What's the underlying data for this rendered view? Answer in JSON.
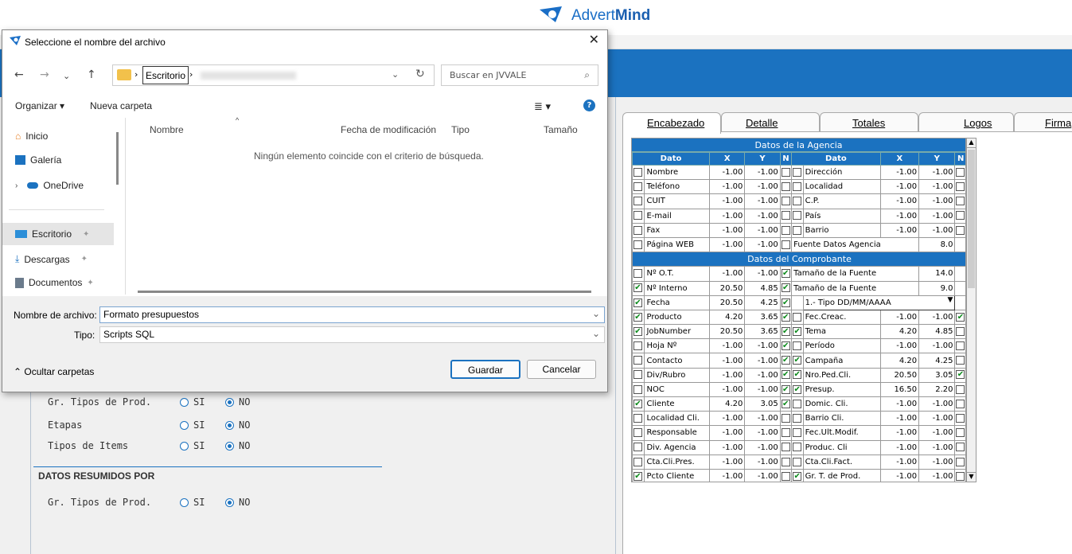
{
  "brand": {
    "name_plain": "Advert",
    "name_bold": "Mind"
  },
  "tabs": [
    "Encabezado",
    "Detalle",
    "Totales",
    "Logos",
    "Firma"
  ],
  "grid": {
    "section1_title": "Datos de la Agencia",
    "headers": [
      "Dato",
      "X",
      "Y",
      "N",
      "Dato",
      "X",
      "Y",
      "N"
    ],
    "rows1": [
      {
        "c1": false,
        "l": "Nombre",
        "x": "-1.00",
        "y": "-1.00",
        "n": false,
        "c2": false,
        "r": "Dirección",
        "rx": "-1.00",
        "ry": "-1.00",
        "rn": false
      },
      {
        "c1": false,
        "l": "Teléfono",
        "x": "-1.00",
        "y": "-1.00",
        "n": false,
        "c2": false,
        "r": "Localidad",
        "rx": "-1.00",
        "ry": "-1.00",
        "rn": false
      },
      {
        "c1": false,
        "l": "CUIT",
        "x": "-1.00",
        "y": "-1.00",
        "n": false,
        "c2": false,
        "r": "C.P.",
        "rx": "-1.00",
        "ry": "-1.00",
        "rn": false
      },
      {
        "c1": false,
        "l": "E-mail",
        "x": "-1.00",
        "y": "-1.00",
        "n": false,
        "c2": false,
        "r": "País",
        "rx": "-1.00",
        "ry": "-1.00",
        "rn": false
      },
      {
        "c1": false,
        "l": "Fax",
        "x": "-1.00",
        "y": "-1.00",
        "n": false,
        "c2": false,
        "r": "Barrio",
        "rx": "-1.00",
        "ry": "-1.00",
        "rn": false
      }
    ],
    "web_row": {
      "l": "Página WEB",
      "x": "-1.00",
      "y": "-1.00",
      "font_label": "Fuente Datos Agencia",
      "font_val": "8.0"
    },
    "section2_title": "Datos del Comprobante",
    "ot_row": {
      "l": "Nº O.T.",
      "x": "-1.00",
      "y": "-1.00",
      "n": true,
      "fl": "Tamaño de la Fuente",
      "fv": "14.0"
    },
    "int_row": {
      "l": "Nº Interno",
      "x": "20.50",
      "y": "4.85",
      "n": true,
      "fl": "Tamaño de la Fuente",
      "fv": "9.0"
    },
    "fecha_row": {
      "l": "Fecha",
      "x": "20.50",
      "y": "4.25",
      "n": true,
      "sel": "1.- Tipo DD/MM/AAAA"
    },
    "rows2": [
      {
        "c1": true,
        "l": "Producto",
        "x": "4.20",
        "y": "3.65",
        "n": true,
        "c2": false,
        "r": "Fec.Creac.",
        "rx": "-1.00",
        "ry": "-1.00",
        "rn": true
      },
      {
        "c1": true,
        "l": "JobNumber",
        "x": "20.50",
        "y": "3.65",
        "n": true,
        "c2": true,
        "r": "Tema",
        "rx": "4.20",
        "ry": "4.85",
        "rn": false
      },
      {
        "c1": false,
        "l": "Hoja Nº",
        "x": "-1.00",
        "y": "-1.00",
        "n": true,
        "c2": false,
        "r": "Período",
        "rx": "-1.00",
        "ry": "-1.00",
        "rn": false
      },
      {
        "c1": false,
        "l": "Contacto",
        "x": "-1.00",
        "y": "-1.00",
        "n": true,
        "c2": true,
        "r": "Campaña",
        "rx": "4.20",
        "ry": "4.25",
        "rn": false
      },
      {
        "c1": false,
        "l": "Div/Rubro",
        "x": "-1.00",
        "y": "-1.00",
        "n": true,
        "c2": true,
        "r": "Nro.Ped.Cli.",
        "rx": "20.50",
        "ry": "3.05",
        "rn": true
      },
      {
        "c1": false,
        "l": "NOC",
        "x": "-1.00",
        "y": "-1.00",
        "n": true,
        "c2": true,
        "r": "Presup.",
        "rx": "16.50",
        "ry": "2.20",
        "rn": false
      },
      {
        "c1": true,
        "l": "Cliente",
        "x": "4.20",
        "y": "3.05",
        "n": true,
        "c2": false,
        "r": "Domic. Cli.",
        "rx": "-1.00",
        "ry": "-1.00",
        "rn": false
      },
      {
        "c1": false,
        "l": "Localidad Cli.",
        "x": "-1.00",
        "y": "-1.00",
        "n": false,
        "c2": false,
        "r": "Barrio Cli.",
        "rx": "-1.00",
        "ry": "-1.00",
        "rn": false
      },
      {
        "c1": false,
        "l": "Responsable",
        "x": "-1.00",
        "y": "-1.00",
        "n": false,
        "c2": false,
        "r": "Fec.Ult.Modif.",
        "rx": "-1.00",
        "ry": "-1.00",
        "rn": false
      },
      {
        "c1": false,
        "l": "Div. Agencia",
        "x": "-1.00",
        "y": "-1.00",
        "n": false,
        "c2": false,
        "r": "Produc. Cli",
        "rx": "-1.00",
        "ry": "-1.00",
        "rn": false
      },
      {
        "c1": false,
        "l": "Cta.Cli.Pres.",
        "x": "-1.00",
        "y": "-1.00",
        "n": false,
        "c2": false,
        "r": "Cta.Cli.Fact.",
        "rx": "-1.00",
        "ry": "-1.00",
        "rn": false
      },
      {
        "c1": true,
        "l": "Pcto Cliente",
        "x": "-1.00",
        "y": "-1.00",
        "n": false,
        "c2": true,
        "r": "Gr. T. de Prod.",
        "rx": "-1.00",
        "ry": "-1.00",
        "rn": false
      }
    ]
  },
  "left": {
    "rows": [
      {
        "label": "Gr. Tipos de Prod.",
        "si": "SI",
        "no": "NO",
        "val": "NO"
      },
      {
        "label": "Etapas",
        "si": "SI",
        "no": "NO",
        "val": "NO"
      },
      {
        "label": "Tipos de Items",
        "si": "SI",
        "no": "NO",
        "val": "NO"
      }
    ],
    "section": "DATOS RESUMIDOS POR",
    "row4": {
      "label": "Gr. Tipos de Prod.",
      "si": "SI",
      "no": "NO",
      "val": "NO"
    }
  },
  "dialog": {
    "title": "Seleccione el nombre del archivo",
    "crumb": "Escritorio",
    "search_placeholder": "Buscar en JVVALE",
    "organize": "Organizar ▾",
    "new_folder": "Nueva carpeta",
    "side": [
      "Inicio",
      "Galería",
      "OneDrive",
      "Escritorio",
      "Descargas",
      "Documentos"
    ],
    "cols": [
      "Nombre",
      "Fecha de modificación",
      "Tipo",
      "Tamaño"
    ],
    "empty": "Ningún elemento coincide con el criterio de búsqueda.",
    "filename_label": "Nombre de archivo:",
    "filename": "Formato presupuestos",
    "type_label": "Tipo:",
    "type": "Scripts SQL",
    "hide": "Ocultar carpetas",
    "save": "Guardar",
    "cancel": "Cancelar"
  }
}
